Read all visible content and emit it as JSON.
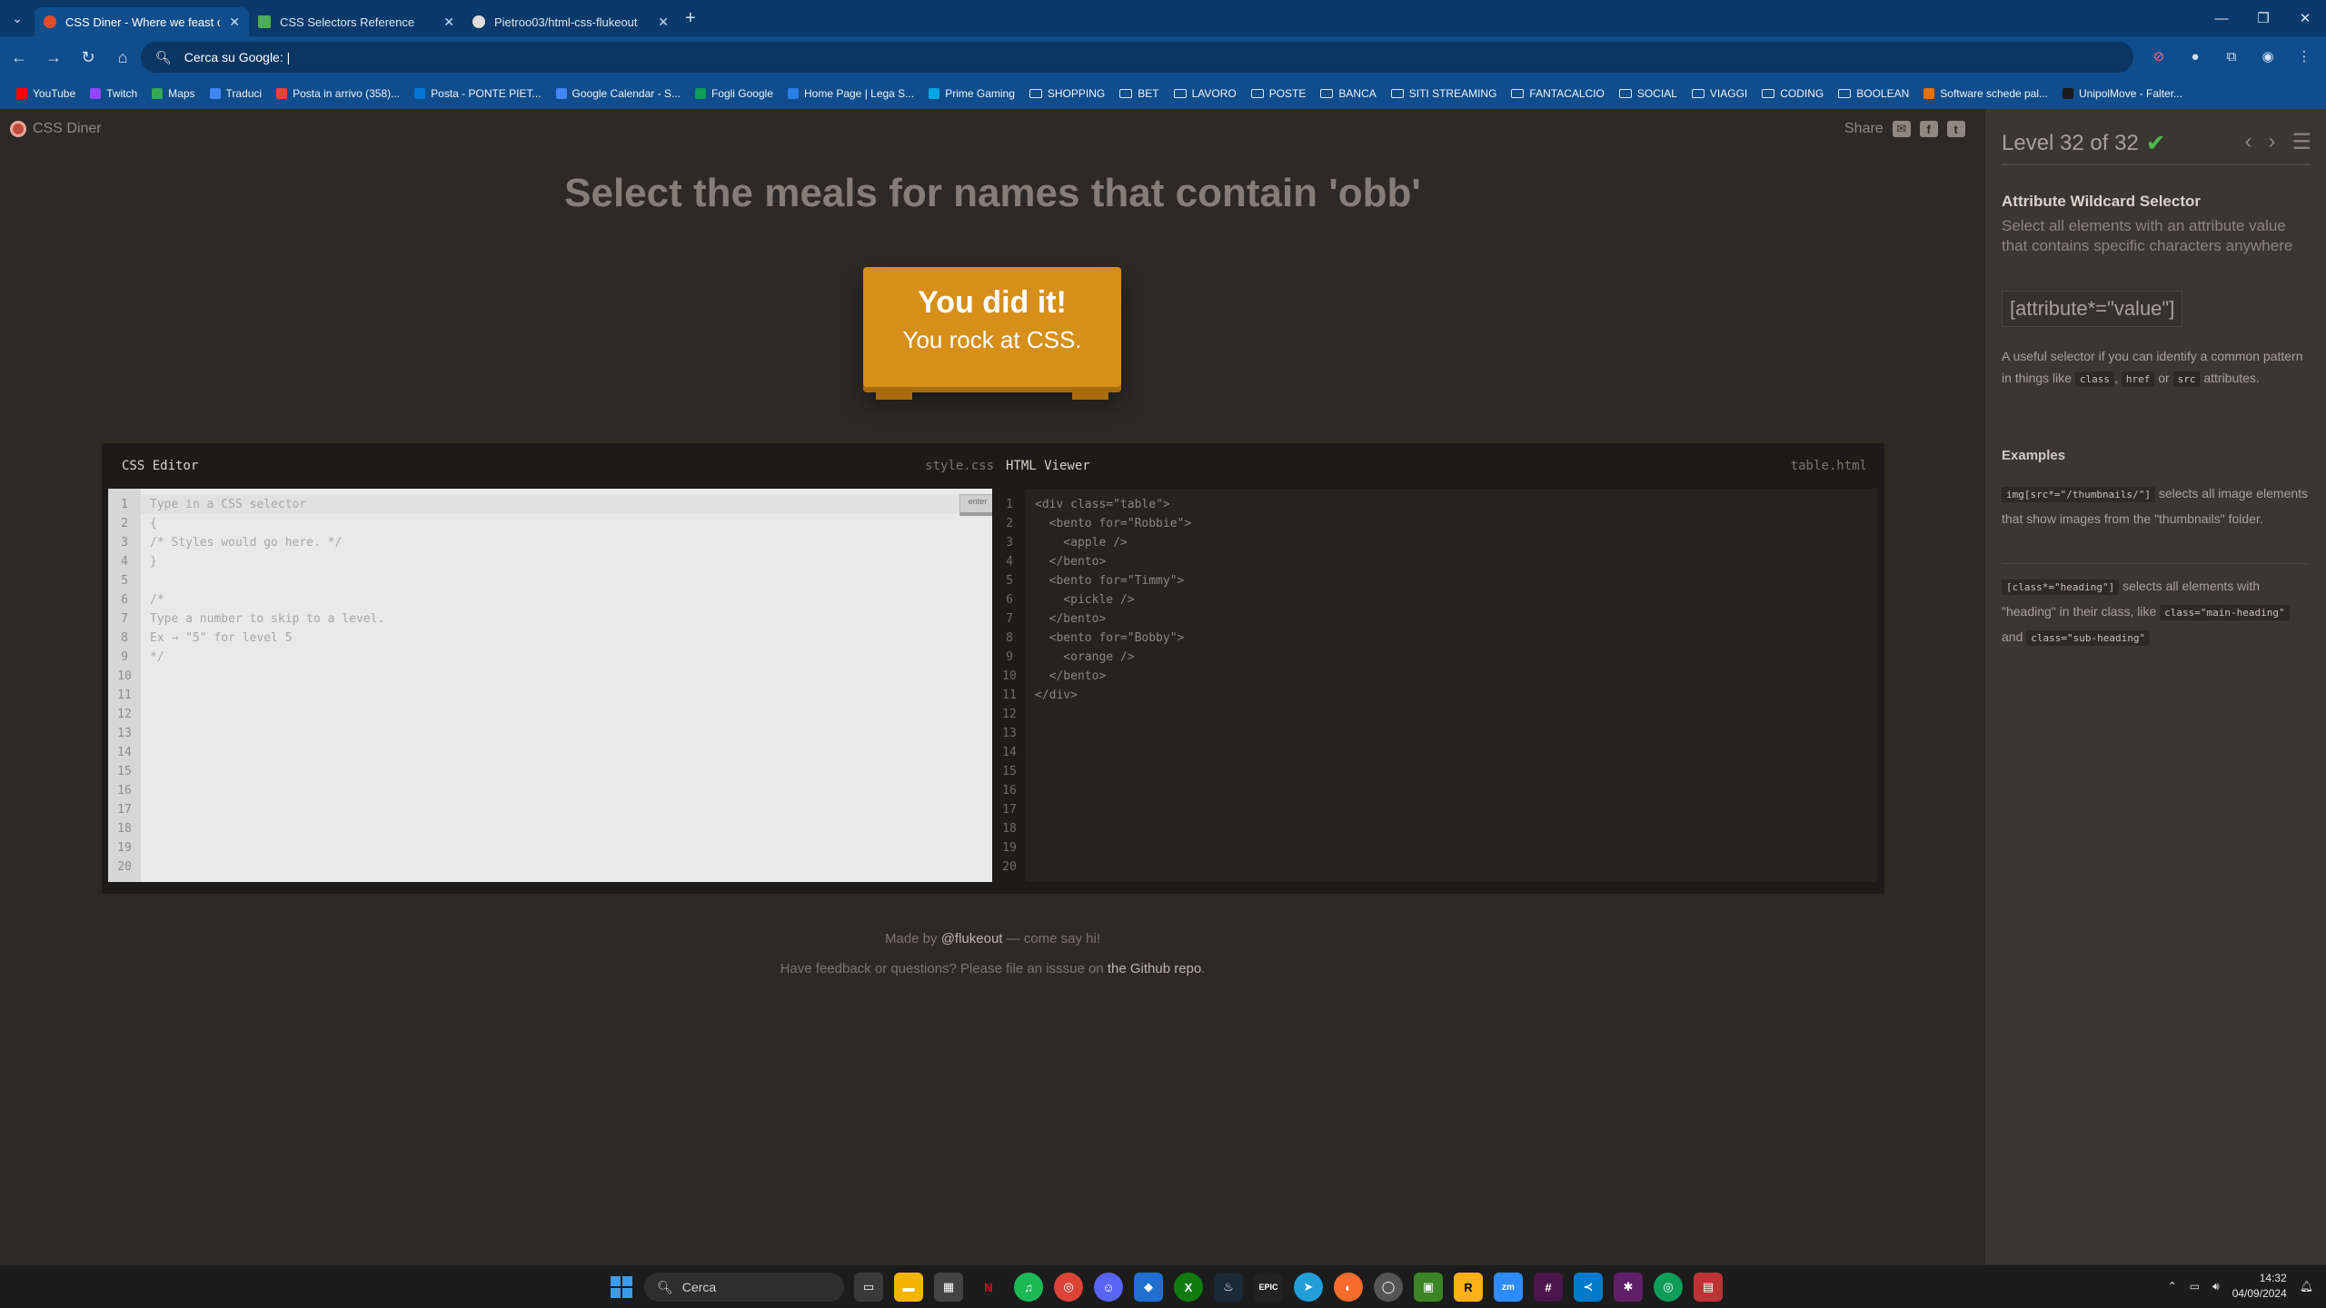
{
  "browser": {
    "tabs": [
      {
        "title": "CSS Diner - Where we feast on",
        "active": true,
        "color": "#e34c26"
      },
      {
        "title": "CSS Selectors Reference",
        "active": false,
        "color": "#4caf50"
      },
      {
        "title": "Pietroo03/html-css-flukeout",
        "active": false,
        "color": "#dddddd"
      }
    ],
    "address": "Cerca su Google: |",
    "bookmarks": [
      {
        "label": "YouTube",
        "icon": "youtube-icon",
        "color": "#ff0000"
      },
      {
        "label": "Twitch",
        "icon": "twitch-icon",
        "color": "#9146ff"
      },
      {
        "label": "Maps",
        "icon": "maps-icon",
        "color": "#34a853"
      },
      {
        "label": "Traduci",
        "icon": "translate-icon",
        "color": "#4285f4"
      },
      {
        "label": "Posta in arrivo (358)...",
        "icon": "mail-icon",
        "color": "#ea4335"
      },
      {
        "label": "Posta - PONTE PIET...",
        "icon": "outlook-icon",
        "color": "#0078d4"
      },
      {
        "label": "Google Calendar - S...",
        "icon": "calendar-icon",
        "color": "#4285f4"
      },
      {
        "label": "Fogli Google",
        "icon": "sheets-icon",
        "color": "#0f9d58"
      },
      {
        "label": "Home Page | Lega S...",
        "icon": "lega-icon",
        "color": "#2a7de1"
      },
      {
        "label": "Prime Gaming",
        "icon": "prime-icon",
        "color": "#00a8e1"
      },
      {
        "label": "SHOPPING",
        "icon": "folder-icon",
        "folder": true
      },
      {
        "label": "BET",
        "icon": "folder-icon",
        "folder": true
      },
      {
        "label": "LAVORO",
        "icon": "folder-icon",
        "folder": true
      },
      {
        "label": "POSTE",
        "icon": "folder-icon",
        "folder": true
      },
      {
        "label": "BANCA",
        "icon": "folder-icon",
        "folder": true
      },
      {
        "label": "SITI STREAMING",
        "icon": "folder-icon",
        "folder": true
      },
      {
        "label": "FANTACALCIO",
        "icon": "folder-icon",
        "folder": true
      },
      {
        "label": "SOCIAL",
        "icon": "folder-icon",
        "folder": true
      },
      {
        "label": "VIAGGI",
        "icon": "folder-icon",
        "folder": true
      },
      {
        "label": "CODING",
        "icon": "folder-icon",
        "folder": true
      },
      {
        "label": "BOOLEAN",
        "icon": "folder-icon",
        "folder": true
      },
      {
        "label": "Software schede pal...",
        "icon": "software-icon",
        "color": "#e8710a"
      },
      {
        "label": "UnipolMove - Falter...",
        "icon": "unipol-icon",
        "color": "#1a1a1a"
      }
    ]
  },
  "page": {
    "logo": "CSS Diner",
    "share": "Share",
    "instruction": "Select the meals for names that contain 'obb'",
    "victory": {
      "line1": "You did it!",
      "line2": "You rock at CSS."
    },
    "editor": {
      "css_title": "CSS Editor",
      "css_file": "style.css",
      "html_title": "HTML Viewer",
      "html_file": "table.html",
      "enter_label": "enter",
      "line_numbers": "1\n2\n3\n4\n5\n6\n7\n8\n9\n10\n11\n12\n13\n14\n15\n16\n17\n18\n19\n20",
      "css_code": "Type in a CSS selector\n{\n/* Styles would go here. */\n}\n\n/*\nType a number to skip to a level.\nEx → \"5\" for level 5\n*/",
      "html_code": "<div class=\"table\">\n  <bento for=\"Robbie\">\n    <apple />\n  </bento>\n  <bento for=\"Timmy\">\n    <pickle />\n  </bento>\n  <bento for=\"Bobby\">\n    <orange />\n  </bento>\n</div>"
    },
    "credits": {
      "made_by_prefix": "Made by ",
      "author": "@flukeout",
      "made_by_suffix": " — come say hi!",
      "feedback_prefix": "Have feedback or questions? Please file an isssue on ",
      "repo": "the Github repo",
      "feedback_suffix": "."
    }
  },
  "sidebar": {
    "level": "Level 32 of 32",
    "check": "✔",
    "title": "Attribute Wildcard Selector",
    "subtitle": "Select all elements with an attribute value that contains specific characters anywhere",
    "syntax": "[attribute*=\"value\"]",
    "hint_prefix": "A useful selector if you can identify a common pattern in things like",
    "hint_tags": [
      "class",
      "href",
      "src"
    ],
    "hint_sep1": ",",
    "hint_or": "or",
    "hint_suffix": "attributes.",
    "examples_title": "Examples",
    "example1_code": "img[src*=\"/thumbnails/\"]",
    "example1_text": "selects all image elements that show images from the \"thumbnails\" folder.",
    "example2_code": "[class*=\"heading\"]",
    "example2_text_a": "selects all elements with \"heading\" in their class, like",
    "example2_code2": "class=\"main-heading\"",
    "example2_and": "and",
    "example2_code3": "class=\"sub-heading\""
  },
  "taskbar": {
    "search": "Cerca",
    "time": "14:32",
    "date": "04/09/2024"
  }
}
